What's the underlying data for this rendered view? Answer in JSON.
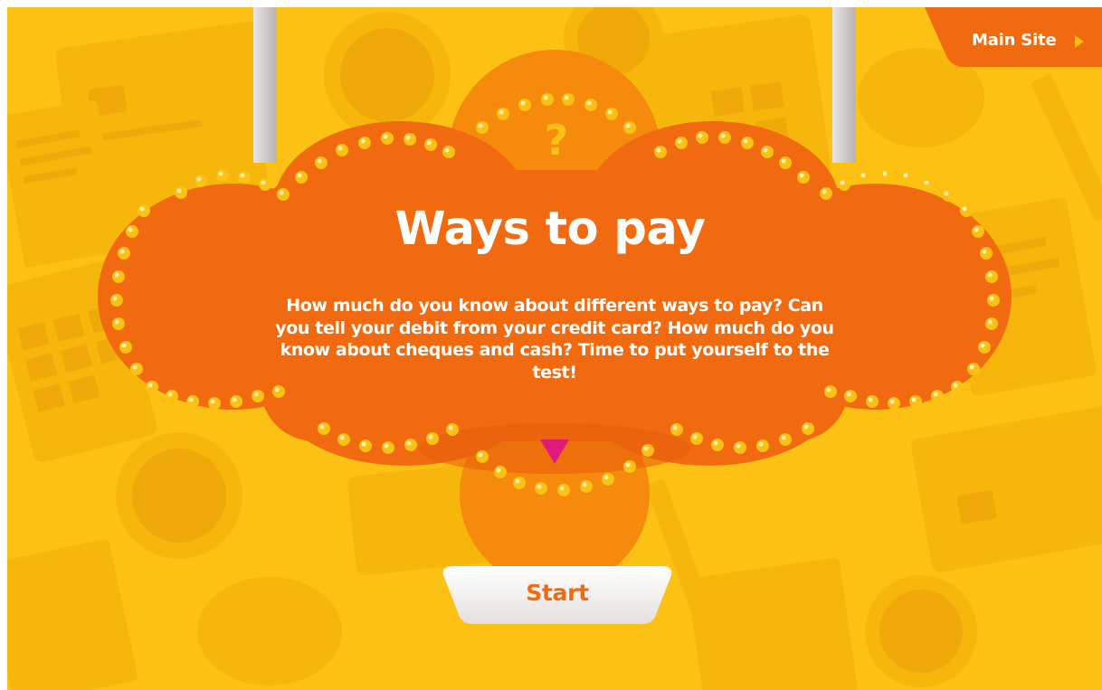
{
  "nav": {
    "main_site_label": "Main Site"
  },
  "sign": {
    "badge_symbol": "?",
    "title": "Ways to pay",
    "description": "How much do you know about different ways to pay? Can you tell your debit from your credit card? How much do you know about cheques and cash? Time to put yourself to the test!"
  },
  "actions": {
    "start_label": "Start"
  },
  "icons": {
    "main_site_arrow": "play-arrow-icon",
    "sign_pointer": "triangle-down-icon",
    "background": [
      "credit-card-icon",
      "euro-coin-icon",
      "calculator-icon",
      "piggy-bank-icon",
      "wallet-icon",
      "document-icon",
      "pencil-icon"
    ]
  },
  "colors": {
    "background": "#fcc112",
    "sign": "#f26a0f",
    "bulb": "#fcc112",
    "pointer": "#e0197d",
    "start_text": "#f26a0f",
    "text": "#ffffff"
  }
}
